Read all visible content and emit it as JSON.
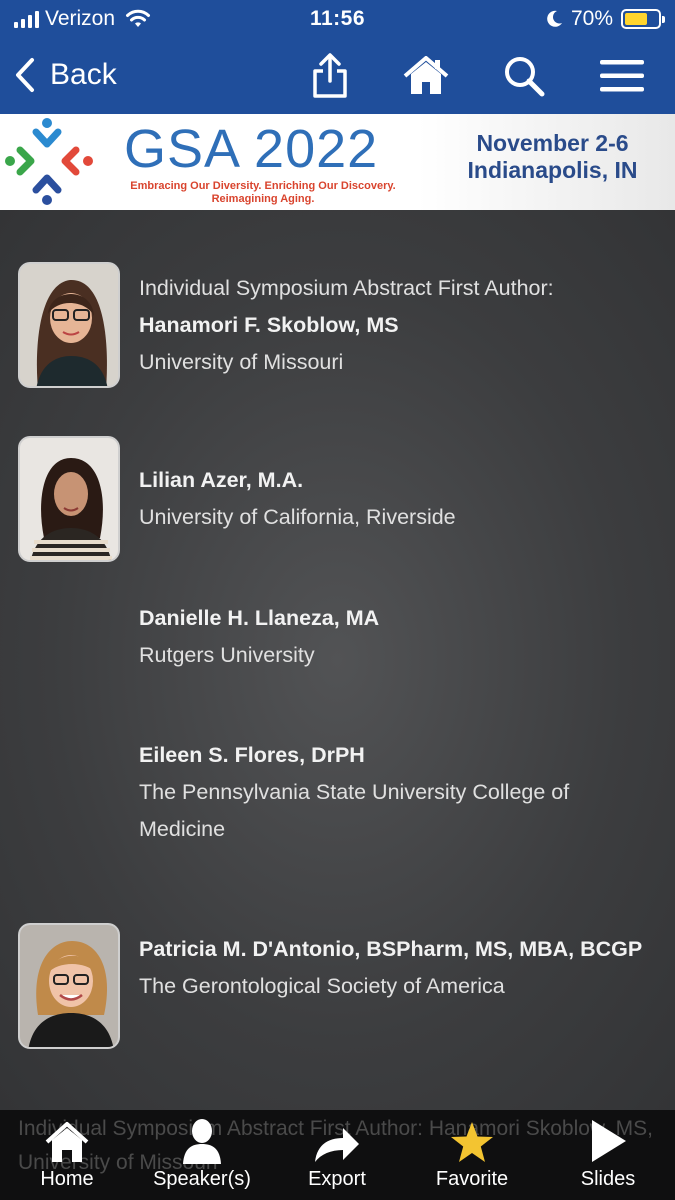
{
  "status": {
    "carrier": "Verizon",
    "time": "11:56",
    "battery": "70%",
    "battery_level": 0.7
  },
  "nav": {
    "back_label": "Back",
    "icons": [
      "share-icon",
      "home-icon",
      "search-icon",
      "menu-icon"
    ]
  },
  "banner": {
    "title": "GSA 2022",
    "tagline": "Embracing Our Diversity.  Enriching Our Discovery. Reimagining Aging.",
    "date": "November 2-6",
    "location": "Indianapolis, IN"
  },
  "speakers": [
    {
      "role": "Individual Symposium Abstract First Author:",
      "name": "Hanamori F. Skoblow, MS",
      "affiliation": "University of Missouri",
      "has_photo": true
    },
    {
      "name": "Lilian Azer, M.A.",
      "affiliation": "University of California, Riverside",
      "has_photo": true
    },
    {
      "name": "Danielle H. Llaneza, MA",
      "affiliation": "Rutgers University",
      "has_photo": false
    },
    {
      "name": "Eileen S. Flores, DrPH",
      "affiliation": "The Pennsylvania State University College of Medicine",
      "has_photo": false
    },
    {
      "name": "Patricia M. D'Antonio, BSPharm, MS, MBA, BCGP",
      "affiliation": "The Gerontological Society of America",
      "has_photo": true
    }
  ],
  "footer_ghost_text": "Individual Symposium Abstract First Author: Hanamori Skoblow, MS, University of Missouri",
  "tabs": [
    {
      "label": "Home",
      "icon": "home-icon"
    },
    {
      "label": "Speaker(s)",
      "icon": "person-icon"
    },
    {
      "label": "Export",
      "icon": "export-arrow-icon"
    },
    {
      "label": "Favorite",
      "icon": "star-icon"
    },
    {
      "label": "Slides",
      "icon": "play-icon"
    }
  ],
  "colors": {
    "nav_blue": "#1f4e9b",
    "brand_blue": "#2f6fb8",
    "brand_red": "#d9442e",
    "star_gold": "#f3c431"
  }
}
